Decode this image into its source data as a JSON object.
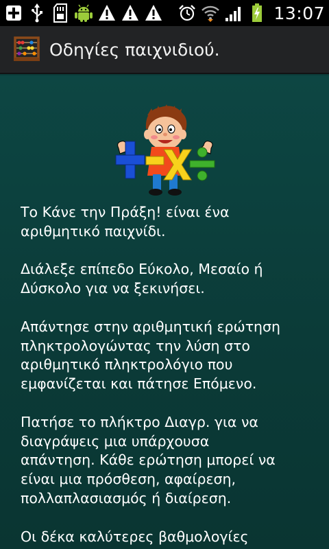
{
  "status_bar": {
    "time": "13:07",
    "icons": [
      "add-icon",
      "usb-icon",
      "sd-card-icon",
      "android-icon",
      "warning-icon",
      "warning-icon",
      "warning-icon",
      "alarm-icon",
      "wifi-icon",
      "signal-icon",
      "battery-charging-icon"
    ]
  },
  "action_bar": {
    "title": "Οδηγίες παιχνιδιού.",
    "icon": "abacus-icon"
  },
  "content": {
    "mascot_icon": "math-kid-mascot",
    "paragraphs": [
      "Το Κάνε την Πράξη! είναι ένα\nαριθμητικό παιχνίδι.",
      "Διάλεξε επίπεδο Εύκολο, Μεσαίο ή\nΔύσκολο για να ξεκινήσει.",
      "Απάντησε στην αριθμητική ερώτηση\nπληκτρολογώντας την λύση στο\nαριθμητικό πληκτρολόγιο που\nεμφανίζεται και πάτησε Επόμενο.",
      "Πατήσε το πλήκτρο Διαγρ. για να\nδιαγράψεις μια υπάρχουσα\nαπάντηση. Κάθε ερώτηση μπορεί να\nείναι μια πρόσθεση, αφαίρεση,\nπολλαπλασιασμός ή διαίρεση.",
      "Οι δέκα καλύτερες βαθμολογίες"
    ]
  },
  "colors": {
    "status_bar": "#000000",
    "action_bar": "#222325",
    "content_bg": "#0d4643",
    "text": "#ffffff"
  }
}
